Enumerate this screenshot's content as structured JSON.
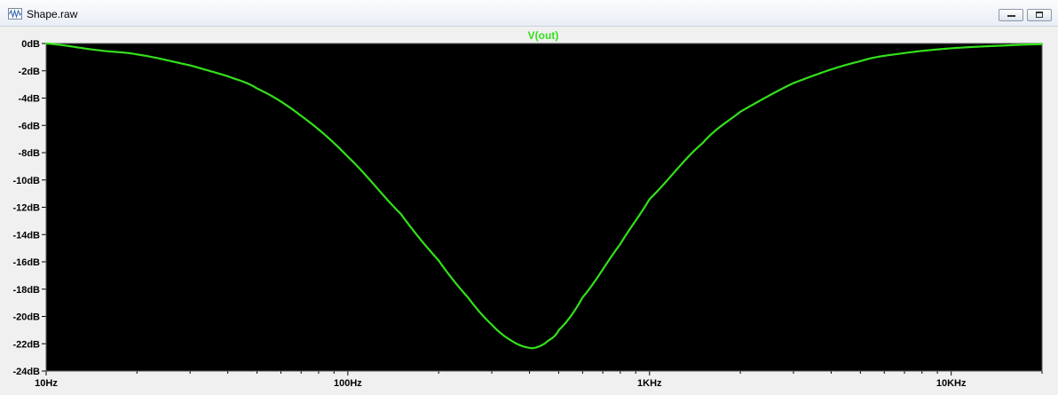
{
  "window": {
    "title": "Shape.raw",
    "app_icon": "waveform-icon",
    "buttons": {
      "minimize": "minimize-icon",
      "maximize": "maximize-icon"
    }
  },
  "chart_data": {
    "type": "line",
    "title": "V(out)",
    "xlabel": "",
    "ylabel": "",
    "x_scale": "log",
    "xlim": [
      10,
      20000
    ],
    "ylim": [
      -24,
      0
    ],
    "y_ticks": [
      0,
      -2,
      -4,
      -6,
      -8,
      -10,
      -12,
      -14,
      -16,
      -18,
      -20,
      -22,
      -24
    ],
    "y_tick_labels": [
      "0dB",
      "-2dB",
      "-4dB",
      "-6dB",
      "-8dB",
      "-10dB",
      "-12dB",
      "-14dB",
      "-16dB",
      "-18dB",
      "-20dB",
      "-22dB",
      "-24dB"
    ],
    "x_ticks": [
      10,
      100,
      1000,
      10000
    ],
    "x_tick_labels": [
      "10Hz",
      "100Hz",
      "1KHz",
      "10KHz"
    ],
    "grid": false,
    "background": "#000000",
    "trace_color": "#33e01a",
    "series": [
      {
        "name": "V(out)",
        "x": [
          10,
          15,
          20,
          30,
          40,
          50,
          70,
          100,
          150,
          200,
          250,
          300,
          350,
          400,
          430,
          460,
          500,
          600,
          800,
          1000,
          1500,
          2000,
          3000,
          5000,
          7000,
          10000,
          15000,
          20000
        ],
        "y": [
          0,
          -0.5,
          -0.8,
          -1.6,
          -2.4,
          -3.3,
          -5.3,
          -8.3,
          -12.5,
          -15.9,
          -18.6,
          -20.6,
          -21.8,
          -22.3,
          -22.2,
          -21.8,
          -21.0,
          -18.6,
          -14.7,
          -11.4,
          -7.3,
          -5.0,
          -2.9,
          -1.3,
          -0.7,
          -0.35,
          -0.15,
          -0.05
        ]
      }
    ]
  }
}
